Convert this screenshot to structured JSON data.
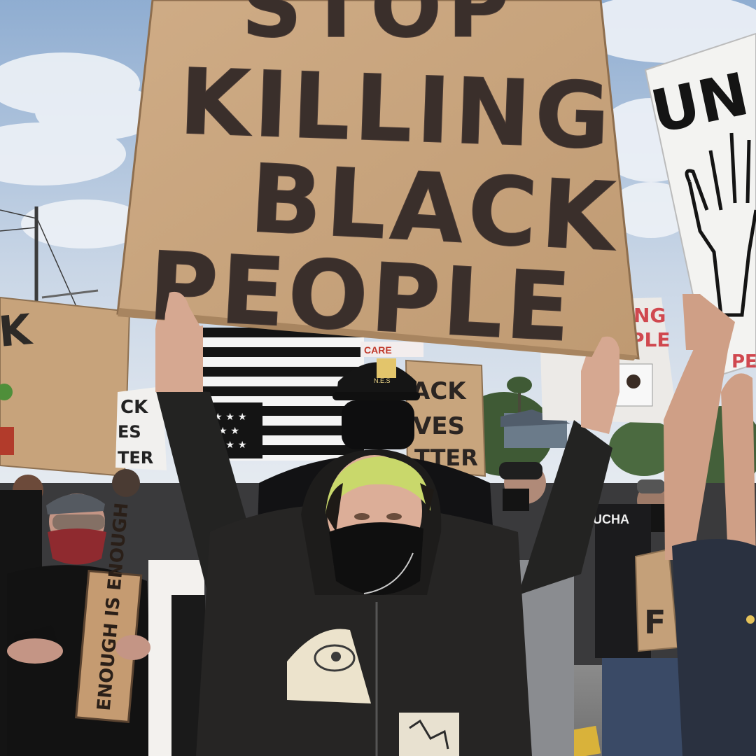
{
  "scene": {
    "description_colors": {
      "sky_top": "#9fb8d6",
      "sky_bottom": "#dfe6ef",
      "cardboard": "#c9a57e",
      "cardboard_dark": "#a88560",
      "marker": "#3a3230",
      "hoodie": "#262524",
      "hair_green": "#c8d86a"
    },
    "main_sign": {
      "line1": "STOP",
      "line2": "KILLING",
      "line3": "BLACK",
      "line4": "PEOPLE"
    },
    "right_sign": {
      "text": "UN",
      "sub": "PE"
    },
    "right_small_sign": {
      "text1": "NG",
      "text2": "PLE"
    },
    "middle_sign": {
      "line1": "ACK",
      "line2": "VES",
      "line3": "TTER"
    },
    "far_left_sign": {
      "line1": "CK",
      "line2": "ES",
      "line3": "TER"
    },
    "small_banner": {
      "text": "CARE"
    },
    "hand_sign": {
      "text": "ENOUGH IS ENOUGH"
    },
    "cap_logo": {
      "text": "N.E.S"
    },
    "shirt_text": {
      "text": "UCHA"
    },
    "lower_sign": {
      "text": "F"
    }
  }
}
